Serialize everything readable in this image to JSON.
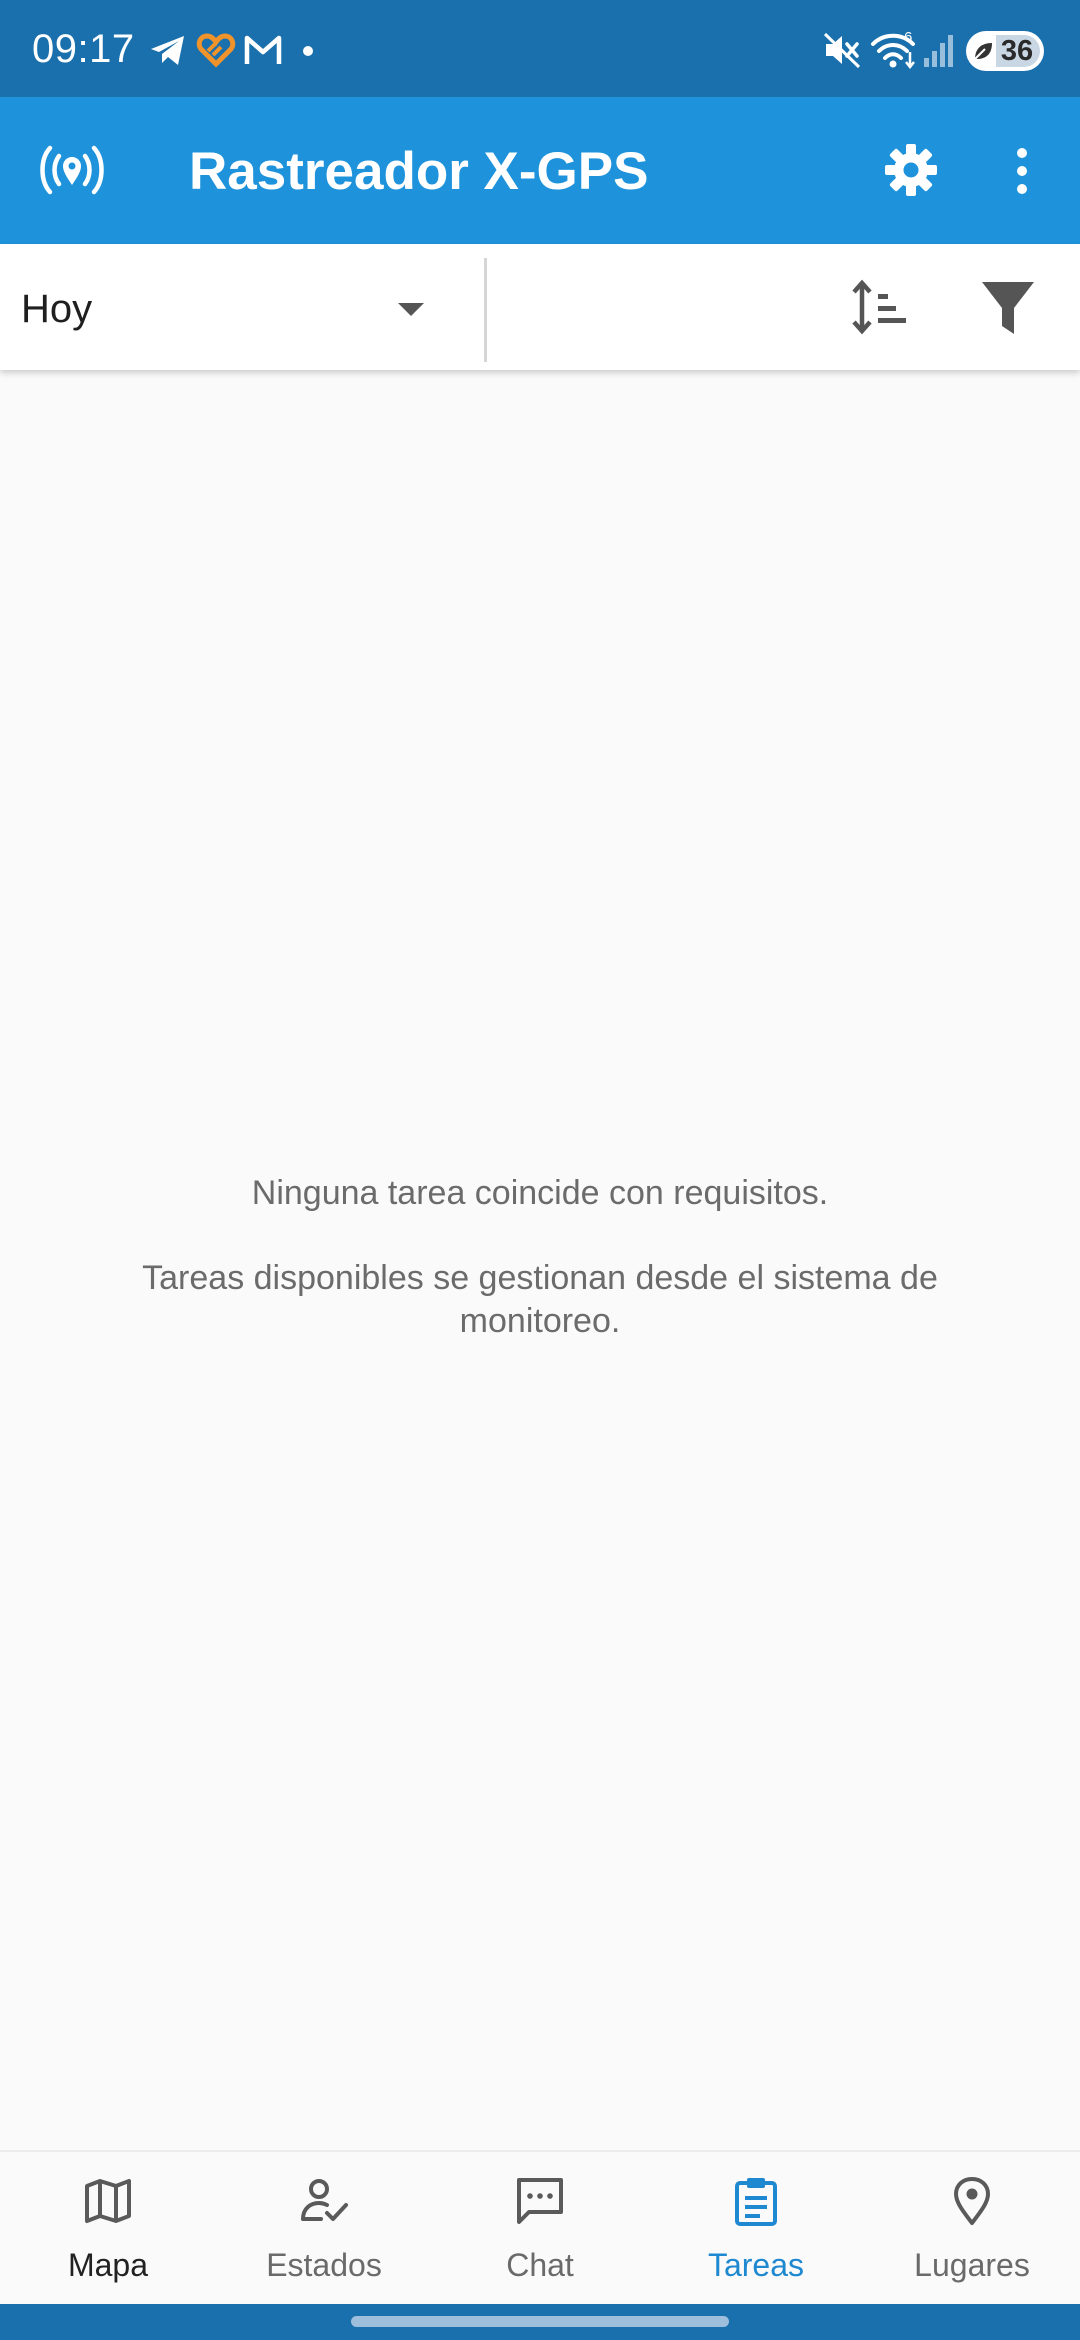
{
  "status_bar": {
    "time": "09:17",
    "battery": "36",
    "network_type_badge": "6",
    "notification_icons": [
      "telegram-icon",
      "heart-app-icon",
      "gmail-icon",
      "dot-icon"
    ],
    "system_icons": [
      "mute-icon",
      "wifi-icon",
      "signal-icon",
      "battery-icon"
    ]
  },
  "app_bar": {
    "title": "Rastreador X-GPS",
    "icons": [
      "gps-broadcast-icon",
      "gear-icon",
      "more-vert-icon"
    ]
  },
  "filter_bar": {
    "period_value": "Hoy",
    "icons": [
      "chevron-down-icon",
      "sort-icon",
      "filter-icon"
    ]
  },
  "empty_state": {
    "line1": "Ninguna tarea coincide con requisitos.",
    "line2": "Tareas disponibles se gestionan desde el sistema de monitoreo."
  },
  "bottom_nav": {
    "items": [
      {
        "label": "Mapa",
        "icon": "map-icon"
      },
      {
        "label": "Estados",
        "icon": "person-check-icon"
      },
      {
        "label": "Chat",
        "icon": "chat-icon"
      },
      {
        "label": "Tareas",
        "icon": "clipboard-icon",
        "active": true
      },
      {
        "label": "Lugares",
        "icon": "location-pin-icon"
      }
    ]
  },
  "colors": {
    "status_bar_bg": "#1a70ad",
    "app_bar_bg": "#1e93dc",
    "accent": "#1e88d0",
    "background": "#fafafa",
    "muted_text": "#6b6b6b"
  }
}
